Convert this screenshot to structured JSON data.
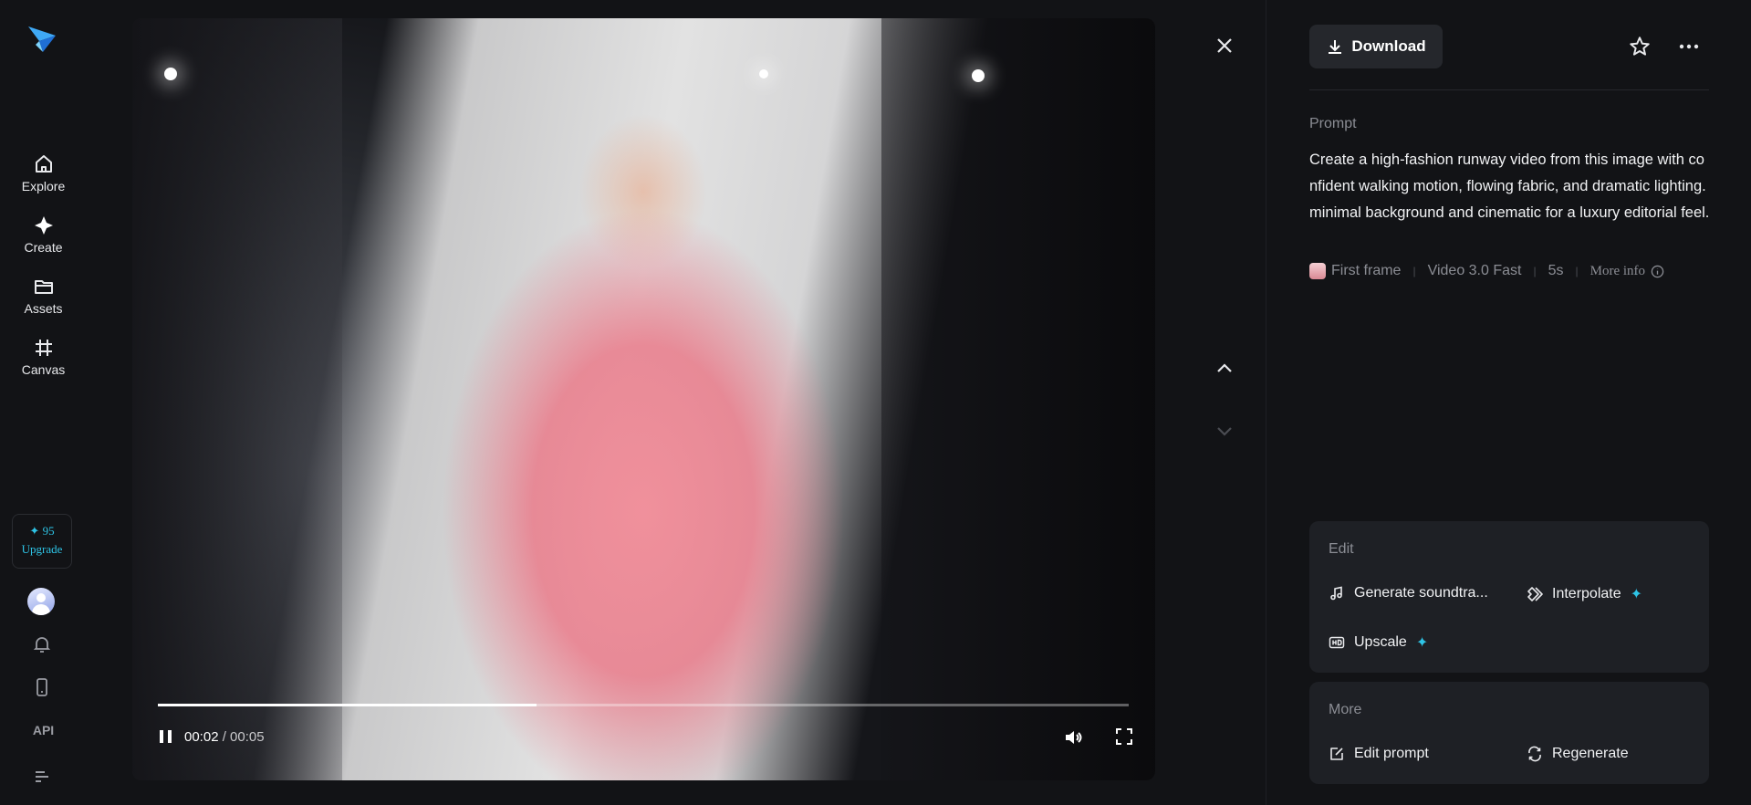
{
  "nav": {
    "items": [
      {
        "label": "Explore",
        "icon": "home-icon"
      },
      {
        "label": "Create",
        "icon": "sparkle-diamond-icon"
      },
      {
        "label": "Assets",
        "icon": "folder-icon"
      },
      {
        "label": "Canvas",
        "icon": "hash-frame-icon"
      }
    ],
    "credits": {
      "count": "✦ 95",
      "upgrade_label": "Upgrade"
    },
    "api_label": "API"
  },
  "player": {
    "current_time": "00:02",
    "duration": "/ 00:05",
    "progress": 0.39
  },
  "panel": {
    "download_label": "Download",
    "prompt_heading": "Prompt",
    "prompt_text": "Create a high-fashion runway video from this image with confident walking motion, flowing fabric, and dramatic lighting. minimal background and cinematic for a luxury editorial feel.",
    "meta": {
      "first_frame": "First frame",
      "model": "Video 3.0 Fast",
      "duration": "5s",
      "more_info": "More info"
    },
    "edit": {
      "title": "Edit",
      "generate_soundtrack": "Generate soundtra...",
      "interpolate": "Interpolate",
      "upscale": "Upscale"
    },
    "more": {
      "title": "More",
      "edit_prompt": "Edit prompt",
      "regenerate": "Regenerate"
    }
  },
  "colors": {
    "accent": "#2ec4e6",
    "background": "#121316",
    "card": "#1e2025"
  }
}
